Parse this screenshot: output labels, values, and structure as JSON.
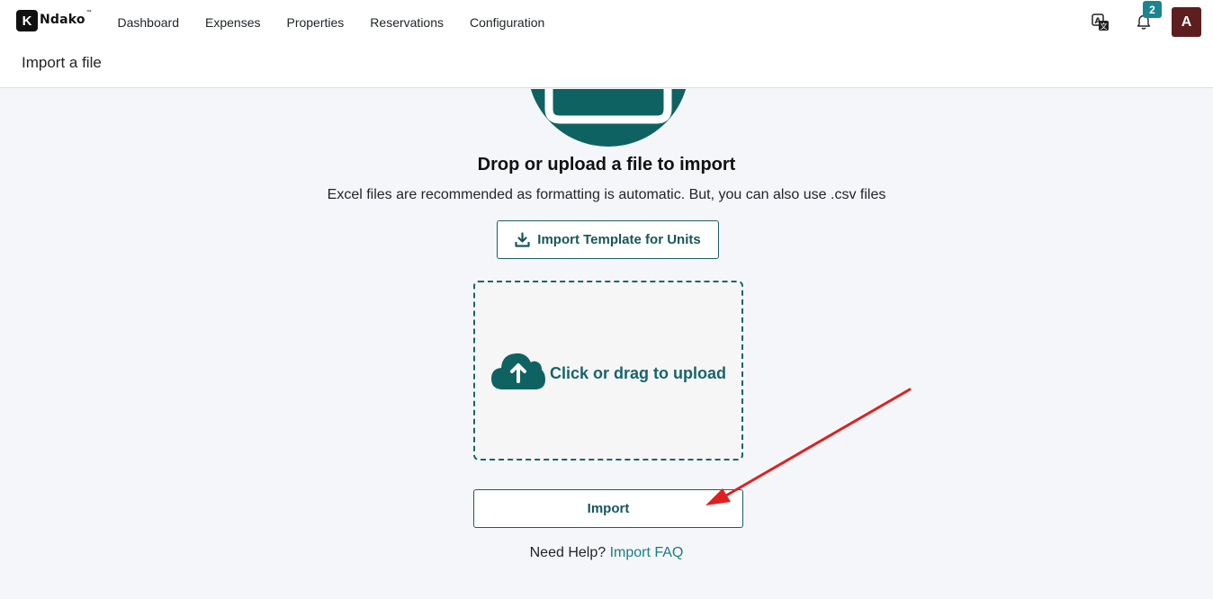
{
  "app": {
    "logo_letter": "K",
    "logo_name": "Ndako",
    "logo_tm": "™"
  },
  "nav": {
    "items": [
      {
        "label": "Dashboard"
      },
      {
        "label": "Expenses"
      },
      {
        "label": "Properties"
      },
      {
        "label": "Reservations"
      },
      {
        "label": "Configuration"
      }
    ]
  },
  "header": {
    "notification_count": "2",
    "avatar_initial": "A"
  },
  "breadcrumb": {
    "title": "Import a file"
  },
  "main": {
    "title": "Drop or upload a file to import",
    "subtitle": "Excel files are recommended as formatting is automatic. But, you can also use .csv files",
    "template_button": "Import Template for Units",
    "dropzone_label": "Click or drag to upload",
    "import_button": "Import",
    "help_text": "Need Help?",
    "help_link": "Import FAQ"
  },
  "colors": {
    "accent": "#17656a",
    "badge": "#1a8590",
    "avatar": "#5c1e1e",
    "annotation_arrow": "#e02020"
  },
  "icons": [
    "translate-icon",
    "bell-icon",
    "download-icon",
    "cloud-upload-icon",
    "upload-illustration"
  ]
}
